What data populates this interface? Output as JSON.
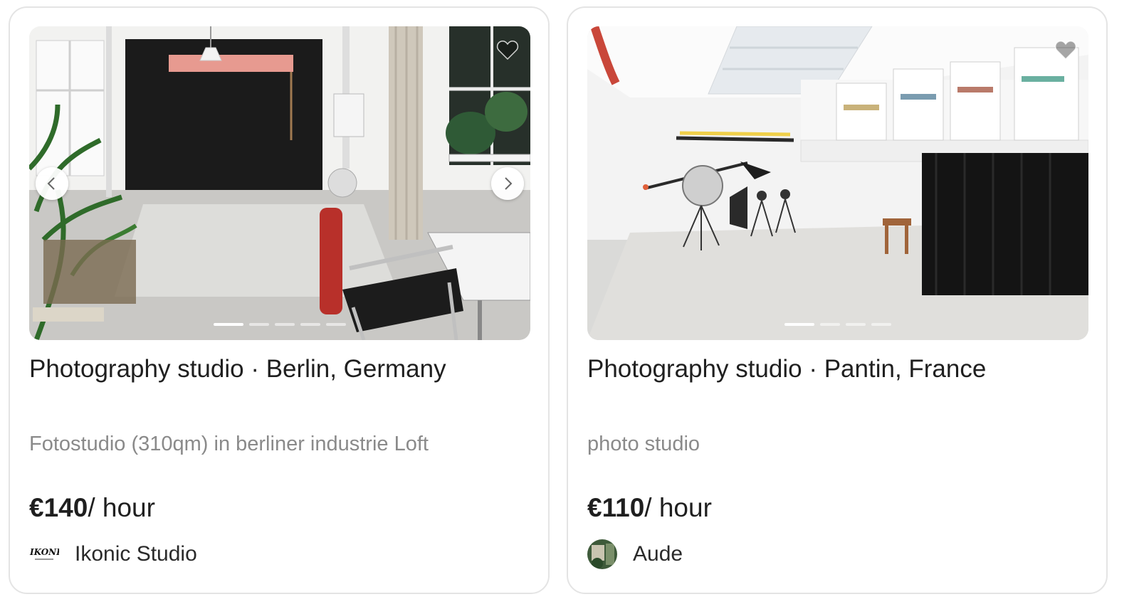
{
  "listings": [
    {
      "title": "Photography studio · Berlin, Germany",
      "description": "Fotostudio (310qm) in berliner industrie Loft",
      "price_amount": "€140",
      "price_unit": "/ hour",
      "host_name": "Ikonic Studio",
      "host_logo_text": "IKONIC",
      "image_count": 5,
      "active_image": 1,
      "icons": {
        "prev": "chevron-left-icon",
        "next": "chevron-right-icon",
        "favorite": "heart-icon"
      }
    },
    {
      "title": "Photography studio · Pantin, France",
      "description": "photo studio",
      "price_amount": "€110",
      "price_unit": "/ hour",
      "host_name": "Aude",
      "image_count": 4,
      "active_image": 1,
      "icons": {
        "favorite": "heart-icon"
      }
    }
  ],
  "colors": {
    "text_primary": "#1f1f1f",
    "text_secondary": "#8a8a8a",
    "card_border": "#e4e4e4"
  }
}
